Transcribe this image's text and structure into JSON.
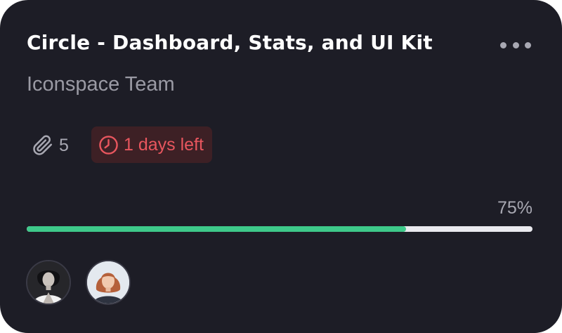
{
  "card": {
    "title": "Circle - Dashboard, Stats, and UI Kit",
    "subtitle": "Iconspace Team",
    "menu_icon": "more-horizontal-icon",
    "attachments": {
      "icon": "paperclip-icon",
      "count": "5"
    },
    "deadline": {
      "icon": "clock-icon",
      "label": "1 days left"
    },
    "progress": {
      "value": 0.75,
      "label": "75%"
    },
    "members": [
      {
        "name": "avatar-1",
        "icon": "person-avatar"
      },
      {
        "name": "avatar-2",
        "icon": "person-avatar"
      }
    ]
  },
  "colors": {
    "card_background": "#1d1d26",
    "progress_fill": "#3ec98a",
    "progress_track": "#e9e9ee",
    "deadline_text": "#e8565e",
    "deadline_background": "#3d2025",
    "muted_text": "#a8a8b2"
  }
}
